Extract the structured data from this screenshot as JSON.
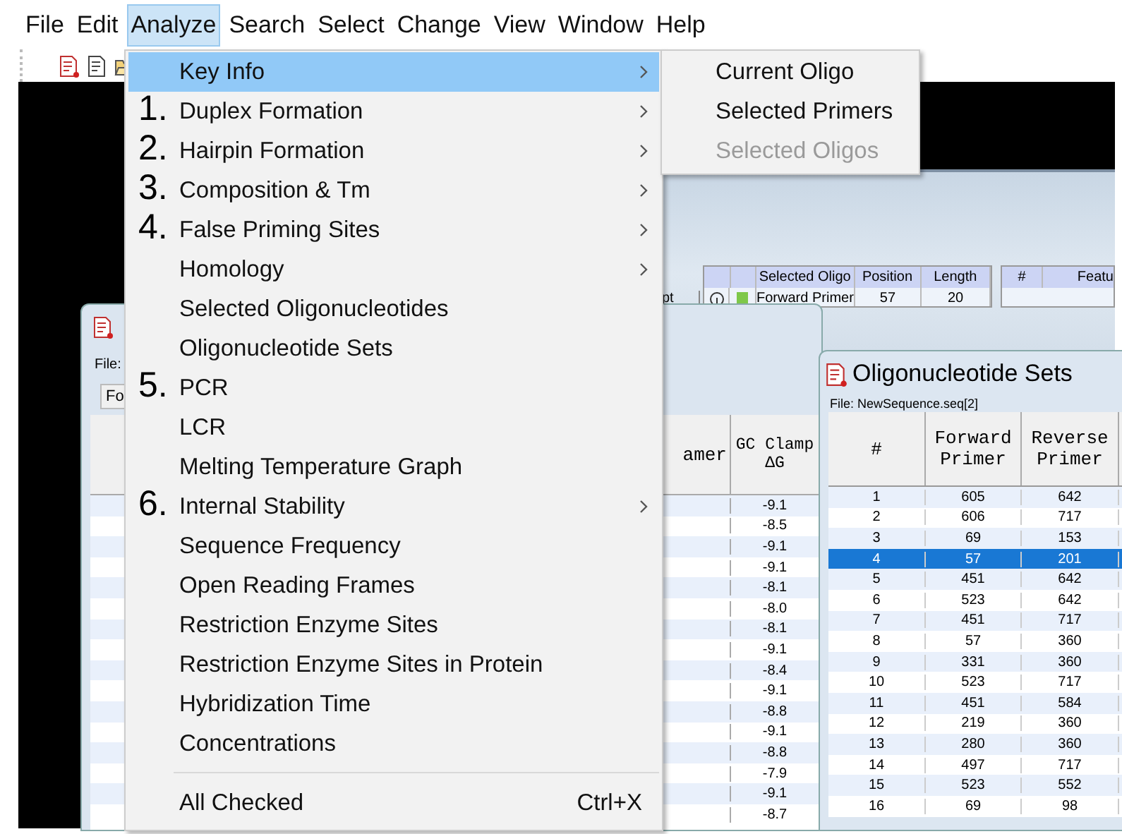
{
  "menubar": [
    {
      "label": "File",
      "selected": false
    },
    {
      "label": "Edit",
      "selected": false
    },
    {
      "label": "Analyze",
      "selected": true
    },
    {
      "label": "Search",
      "selected": false
    },
    {
      "label": "Select",
      "selected": false
    },
    {
      "label": "Change",
      "selected": false
    },
    {
      "label": "View",
      "selected": false
    },
    {
      "label": "Window",
      "selected": false
    },
    {
      "label": "Help",
      "selected": false
    }
  ],
  "back_window": {
    "column_1": "pt",
    "columns": [
      "Selected Oligo",
      "Position",
      "Length"
    ],
    "row": [
      "Forward Primer",
      "57",
      "20"
    ],
    "columns_2": [
      "#",
      "Featu"
    ]
  },
  "gc_window": {
    "file_label": "File:",
    "button": "Fo",
    "columns": [
      "amer",
      "GC Clamp\nΔG"
    ],
    "values": [
      "-9.1",
      "-8.5",
      "-9.1",
      "-9.1",
      "-8.1",
      "-8.0",
      "-8.1",
      "-9.1",
      "-8.4",
      "-9.1",
      "-8.8",
      "-9.1",
      "-8.8",
      "-7.9",
      "-9.1",
      "-8.7"
    ]
  },
  "sets_window": {
    "title": "Oligonucleotide Sets",
    "file": "File: NewSequence.seq[2]",
    "columns": [
      "#",
      "Forward\nPrimer",
      "Reverse\nPrimer"
    ],
    "rows": [
      {
        "cells": [
          "1",
          "605",
          "642"
        ],
        "selected": false
      },
      {
        "cells": [
          "2",
          "606",
          "717"
        ],
        "selected": false
      },
      {
        "cells": [
          "3",
          "69",
          "153"
        ],
        "selected": false
      },
      {
        "cells": [
          "4",
          "57",
          "201"
        ],
        "selected": true
      },
      {
        "cells": [
          "5",
          "451",
          "642"
        ],
        "selected": false
      },
      {
        "cells": [
          "6",
          "523",
          "642"
        ],
        "selected": false
      },
      {
        "cells": [
          "7",
          "451",
          "717"
        ],
        "selected": false
      },
      {
        "cells": [
          "8",
          "57",
          "360"
        ],
        "selected": false
      },
      {
        "cells": [
          "9",
          "331",
          "360"
        ],
        "selected": false
      },
      {
        "cells": [
          "10",
          "523",
          "717"
        ],
        "selected": false
      },
      {
        "cells": [
          "11",
          "451",
          "584"
        ],
        "selected": false
      },
      {
        "cells": [
          "12",
          "219",
          "360"
        ],
        "selected": false
      },
      {
        "cells": [
          "13",
          "280",
          "360"
        ],
        "selected": false
      },
      {
        "cells": [
          "14",
          "497",
          "717"
        ],
        "selected": false
      },
      {
        "cells": [
          "15",
          "523",
          "552"
        ],
        "selected": false
      },
      {
        "cells": [
          "16",
          "69",
          "98"
        ],
        "selected": false
      }
    ]
  },
  "analyze_menu": {
    "items": [
      {
        "kind": "item",
        "label": "Key Info",
        "selected": true,
        "submenu": true
      },
      {
        "kind": "item",
        "label": "Duplex Formation",
        "annotation": "1.",
        "selected": false,
        "submenu": true
      },
      {
        "kind": "item",
        "label": "Hairpin Formation",
        "annotation": "2.",
        "selected": false,
        "submenu": true
      },
      {
        "kind": "item",
        "label": "Composition & Tm",
        "annotation": "3.",
        "selected": false,
        "submenu": true
      },
      {
        "kind": "item",
        "label": "False Priming Sites",
        "annotation": "4.",
        "selected": false,
        "submenu": true
      },
      {
        "kind": "item",
        "label": "Homology",
        "selected": false,
        "submenu": true
      },
      {
        "kind": "item",
        "label": "Selected Oligonucleotides",
        "selected": false,
        "submenu": false
      },
      {
        "kind": "item",
        "label": "Oligonucleotide Sets",
        "selected": false,
        "submenu": false
      },
      {
        "kind": "item",
        "label": "PCR",
        "annotation": "5.",
        "selected": false,
        "submenu": false
      },
      {
        "kind": "item",
        "label": "LCR",
        "selected": false,
        "submenu": false
      },
      {
        "kind": "item",
        "label": "Melting Temperature Graph",
        "selected": false,
        "submenu": false
      },
      {
        "kind": "item",
        "label": "Internal Stability",
        "annotation": "6.",
        "selected": false,
        "submenu": true
      },
      {
        "kind": "item",
        "label": "Sequence Frequency",
        "selected": false,
        "submenu": false
      },
      {
        "kind": "item",
        "label": "Open Reading Frames",
        "selected": false,
        "submenu": false
      },
      {
        "kind": "item",
        "label": "Restriction Enzyme Sites",
        "selected": false,
        "submenu": false
      },
      {
        "kind": "item",
        "label": "Restriction Enzyme Sites in Protein",
        "selected": false,
        "submenu": false
      },
      {
        "kind": "item",
        "label": "Hybridization Time",
        "selected": false,
        "submenu": false
      },
      {
        "kind": "item",
        "label": "Concentrations",
        "selected": false,
        "submenu": false
      },
      {
        "kind": "separator"
      },
      {
        "kind": "item",
        "label": "All Checked",
        "shortcut": "Ctrl+X",
        "selected": false,
        "submenu": false
      }
    ]
  },
  "key_info_submenu": {
    "items": [
      {
        "label": "Current Oligo",
        "disabled": false
      },
      {
        "label": "Selected Primers",
        "disabled": false
      },
      {
        "label": "Selected Oligos",
        "disabled": true
      }
    ]
  }
}
